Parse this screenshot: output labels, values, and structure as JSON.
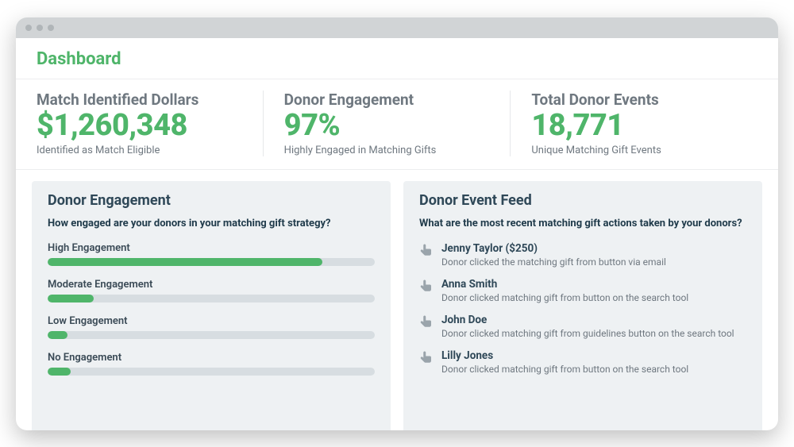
{
  "page_title": "Dashboard",
  "stats": {
    "match_dollars": {
      "title": "Match Identified Dollars",
      "value": "$1,260,348",
      "sub": "Identified as Match Eligible"
    },
    "engagement": {
      "title": "Donor Engagement",
      "value": "97%",
      "sub": "Highly Engaged in Matching Gifts"
    },
    "events": {
      "title": "Total Donor Events",
      "value": "18,771",
      "sub": "Unique Matching Gift Events"
    }
  },
  "engagement_panel": {
    "title": "Donor Engagement",
    "subtitle": "How engaged are your donors in your matching gift strategy?",
    "bars": [
      {
        "label": "High Engagement",
        "percent": 84
      },
      {
        "label": "Moderate Engagement",
        "percent": 14
      },
      {
        "label": "Low Engagement",
        "percent": 6
      },
      {
        "label": "No Engagement",
        "percent": 7
      }
    ]
  },
  "feed_panel": {
    "title": "Donor Event Feed",
    "subtitle": "What are the most recent matching gift actions taken by your donors?",
    "items": [
      {
        "name": "Jenny Taylor ($250)",
        "desc": "Donor clicked the matching gift from button via email"
      },
      {
        "name": "Anna Smith",
        "desc": "Donor clicked matching gift from button on the search tool"
      },
      {
        "name": "John Doe",
        "desc": "Donor clicked matching gift from guidelines button on the search tool"
      },
      {
        "name": "Lilly Jones",
        "desc": "Donor clicked matching gift from button on the search tool"
      }
    ]
  },
  "chart_data": {
    "type": "bar",
    "title": "Donor Engagement",
    "categories": [
      "High Engagement",
      "Moderate Engagement",
      "Low Engagement",
      "No Engagement"
    ],
    "values": [
      84,
      14,
      6,
      7
    ],
    "xlabel": "",
    "ylabel": "",
    "ylim": [
      0,
      100
    ]
  }
}
